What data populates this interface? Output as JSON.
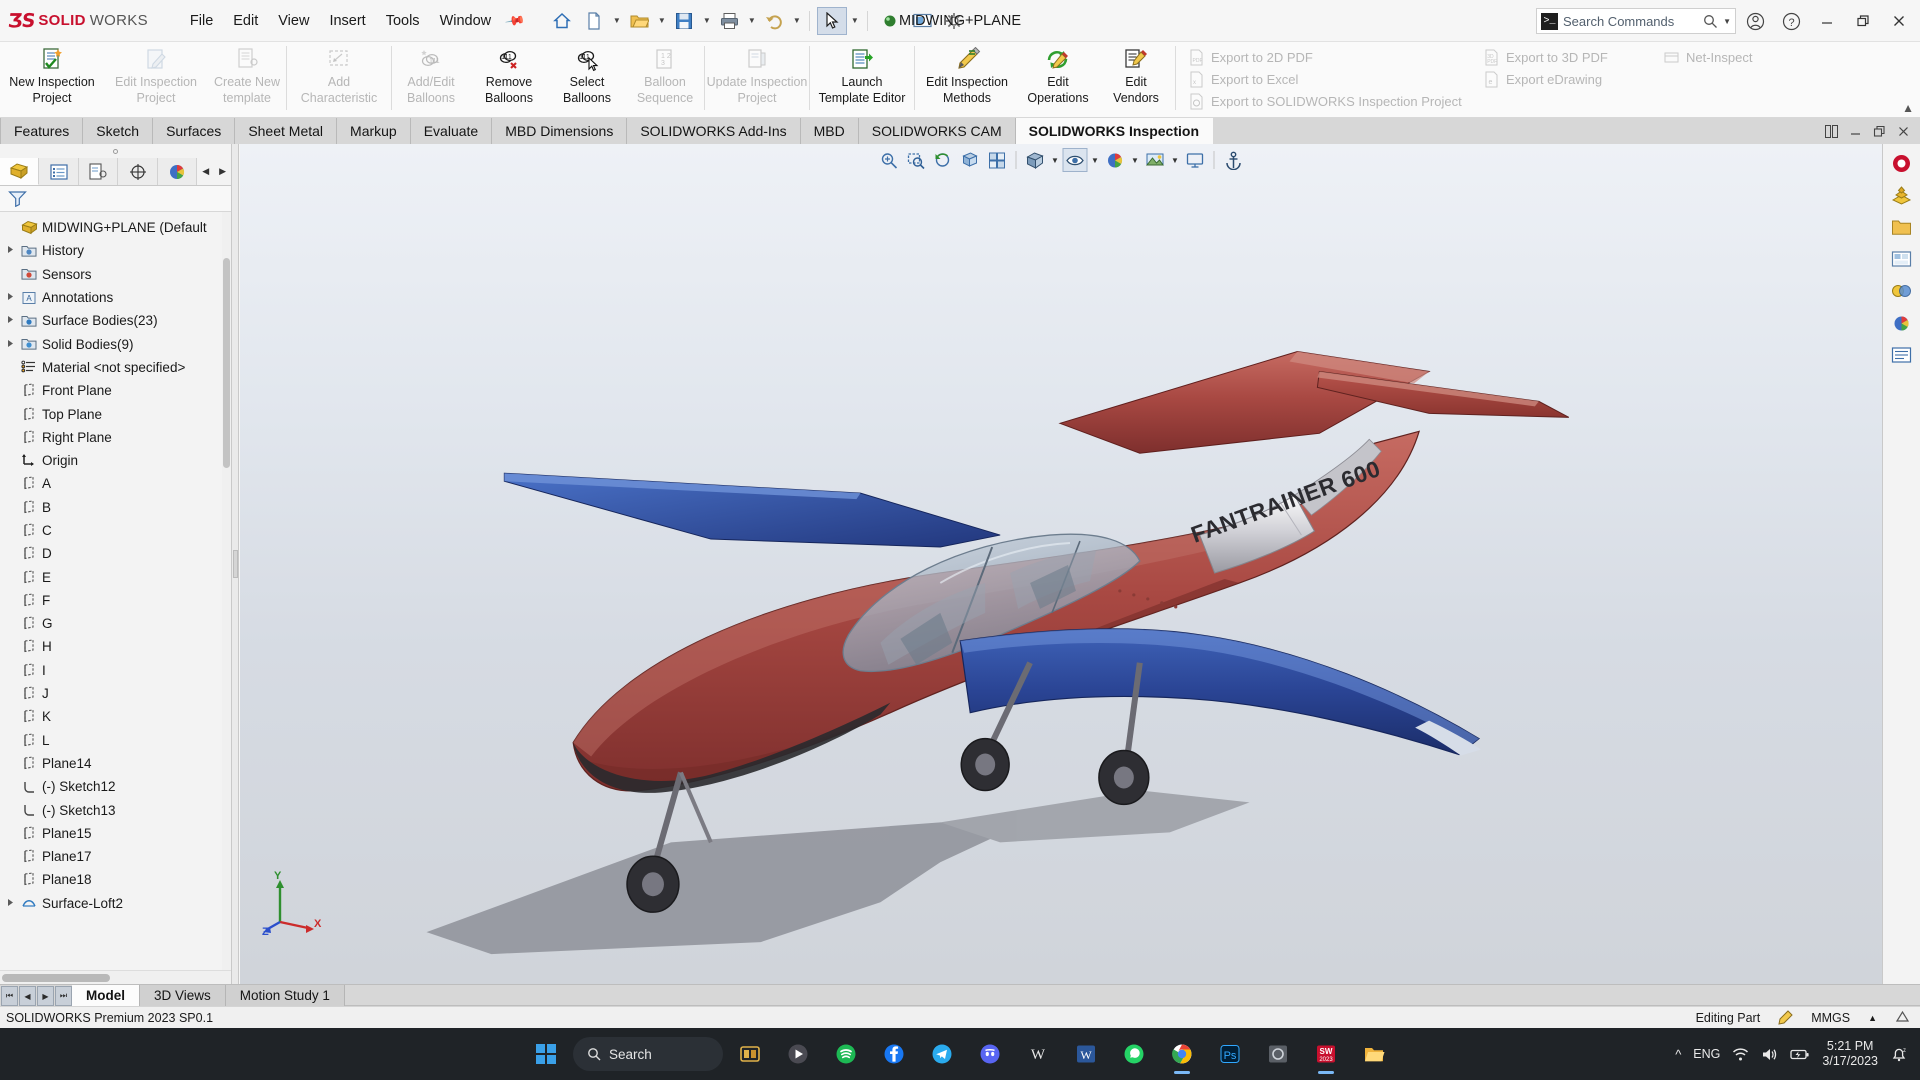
{
  "app": {
    "brand_ds": "ƷS",
    "brand_solid": "SOLID",
    "brand_works": "WORKS",
    "document_title": "MIDWING+PLANE",
    "accent_red": "#c8102e"
  },
  "menubar": {
    "items": [
      {
        "label": "File"
      },
      {
        "label": "Edit"
      },
      {
        "label": "View"
      },
      {
        "label": "Insert"
      },
      {
        "label": "Tools"
      },
      {
        "label": "Window"
      }
    ],
    "pin_icon": "pushpin-icon"
  },
  "quick_access": {
    "buttons": [
      {
        "name": "home-icon"
      },
      {
        "name": "new-document-icon",
        "caret": true
      },
      {
        "name": "open-folder-icon",
        "caret": true
      },
      {
        "name": "save-icon",
        "caret": true
      },
      {
        "name": "print-icon",
        "caret": true
      },
      {
        "name": "undo-icon",
        "caret": true
      },
      {
        "name": "select-arrow-icon",
        "caret": true,
        "selected": true
      },
      {
        "name": "rebuild-icon"
      },
      {
        "name": "display-settings-icon"
      },
      {
        "name": "options-gear-icon"
      }
    ]
  },
  "search": {
    "placeholder": "Search Commands",
    "prompt_glyph": ">_",
    "icon": "magnifier-icon"
  },
  "window_controls": {
    "account": "user-account-icon",
    "help": "help-question-icon",
    "minimize": "minimize-icon",
    "restore": "restore-icon",
    "close": "close-icon"
  },
  "ribbon": {
    "groups": [
      {
        "buttons": [
          {
            "label": "New Inspection\nProject",
            "label_l1": "New Inspection",
            "label_l2": "Project",
            "icon": "new-inspection-project-icon",
            "disabled": false,
            "width": "w2"
          },
          {
            "label_l1": "Edit Inspection",
            "label_l2": "Project",
            "icon": "edit-inspection-project-icon",
            "disabled": true,
            "width": "w2"
          },
          {
            "label_l1": "Create New",
            "label_l2": "template",
            "icon": "create-new-template-icon",
            "disabled": true,
            "width": "w3"
          }
        ]
      },
      {
        "buttons": [
          {
            "label_l1": "Add",
            "label_l2": "Characteristic",
            "icon": "add-characteristic-icon",
            "disabled": true,
            "width": "w2"
          }
        ]
      },
      {
        "buttons": [
          {
            "label_l1": "Add/Edit",
            "label_l2": "Balloons",
            "icon": "add-edit-balloons-icon",
            "disabled": true,
            "width": "w3"
          },
          {
            "label_l1": "Remove",
            "label_l2": "Balloons",
            "icon": "remove-balloons-icon",
            "disabled": false,
            "width": "w3"
          },
          {
            "label_l1": "Select",
            "label_l2": "Balloons",
            "icon": "select-balloons-icon",
            "disabled": false,
            "width": "w3"
          },
          {
            "label_l1": "Balloon",
            "label_l2": "Sequence",
            "icon": "balloon-sequence-icon",
            "disabled": true,
            "width": "w3"
          }
        ]
      },
      {
        "buttons": [
          {
            "label_l1": "Update Inspection",
            "label_l2": "Project",
            "icon": "update-inspection-project-icon",
            "disabled": true,
            "width": "w2"
          }
        ]
      },
      {
        "buttons": [
          {
            "label_l1": "Launch",
            "label_l2": "Template Editor",
            "icon": "launch-template-editor-icon",
            "disabled": false,
            "width": "w2"
          }
        ]
      },
      {
        "buttons": [
          {
            "label_l1": "Edit Inspection",
            "label_l2": "Methods",
            "icon": "edit-inspection-methods-icon",
            "disabled": false,
            "width": "w2"
          },
          {
            "label_l1": "Edit",
            "label_l2": "Operations",
            "icon": "edit-operations-icon",
            "disabled": false,
            "width": "w3"
          },
          {
            "label_l1": "Edit",
            "label_l2": "Vendors",
            "icon": "edit-vendors-icon",
            "disabled": false,
            "width": "w3"
          }
        ]
      }
    ],
    "export_column_1": [
      {
        "label": "Export to 2D PDF",
        "icon": "export-2d-pdf-icon",
        "disabled": true
      },
      {
        "label": "Export to Excel",
        "icon": "export-excel-icon",
        "disabled": true
      },
      {
        "label": "Export to SOLIDWORKS Inspection Project",
        "icon": "export-inspection-project-icon",
        "disabled": true
      }
    ],
    "export_column_2": [
      {
        "label": "Export to 3D PDF",
        "icon": "export-3d-pdf-icon",
        "disabled": true
      },
      {
        "label": "Export eDrawing",
        "icon": "export-edrawing-icon",
        "disabled": true
      }
    ],
    "net_inspect": {
      "label": "Net-Inspect",
      "icon": "net-inspect-icon",
      "disabled": true
    },
    "collapse_caret": "chevron-up-icon"
  },
  "command_tabs": {
    "tabs": [
      {
        "label": "Features",
        "active": false
      },
      {
        "label": "Sketch",
        "active": false
      },
      {
        "label": "Surfaces",
        "active": false
      },
      {
        "label": "Sheet Metal",
        "active": false
      },
      {
        "label": "Markup",
        "active": false
      },
      {
        "label": "Evaluate",
        "active": false
      },
      {
        "label": "MBD Dimensions",
        "active": false
      },
      {
        "label": "SOLIDWORKS Add-Ins",
        "active": false
      },
      {
        "label": "MBD",
        "active": false
      },
      {
        "label": "SOLIDWORKS CAM",
        "active": false
      },
      {
        "label": "SOLIDWORKS Inspection",
        "active": true
      }
    ],
    "right_buttons": [
      "tile-windows-icon",
      "minimize-doc-icon",
      "restore-doc-icon",
      "close-doc-icon"
    ]
  },
  "feature_manager": {
    "tabs": [
      {
        "name": "feature-manager-tab",
        "icon": "yellow-block-icon",
        "active": true
      },
      {
        "name": "property-manager-tab",
        "icon": "property-list-icon",
        "active": false
      },
      {
        "name": "configuration-manager-tab",
        "icon": "configuration-icon",
        "active": false
      },
      {
        "name": "dimxpert-manager-tab",
        "icon": "dimxpert-icon",
        "active": false
      },
      {
        "name": "display-manager-tab",
        "icon": "color-wheel-icon",
        "active": false
      }
    ],
    "filter_icon": "filter-funnel-icon",
    "root": {
      "label": "MIDWING+PLANE (Default",
      "icon": "part-icon"
    },
    "items": [
      {
        "label": "History",
        "icon": "history-icon",
        "expandable": true,
        "indent": 1
      },
      {
        "label": "Sensors",
        "icon": "sensors-icon",
        "expandable": false,
        "indent": 1
      },
      {
        "label": "Annotations",
        "icon": "annotations-icon",
        "expandable": true,
        "indent": 1
      },
      {
        "label": "Surface Bodies(23)",
        "icon": "surface-bodies-icon",
        "expandable": true,
        "indent": 1
      },
      {
        "label": "Solid Bodies(9)",
        "icon": "solid-bodies-icon",
        "expandable": true,
        "indent": 1
      },
      {
        "label": "Material <not specified>",
        "icon": "material-icon",
        "expandable": false,
        "indent": 1
      },
      {
        "label": "Front Plane",
        "icon": "plane-icon",
        "expandable": false,
        "indent": 1
      },
      {
        "label": "Top Plane",
        "icon": "plane-icon",
        "expandable": false,
        "indent": 1
      },
      {
        "label": "Right Plane",
        "icon": "plane-icon",
        "expandable": false,
        "indent": 1
      },
      {
        "label": "Origin",
        "icon": "origin-icon",
        "expandable": false,
        "indent": 1
      },
      {
        "label": "A",
        "icon": "plane-icon",
        "expandable": false,
        "indent": 1
      },
      {
        "label": "B",
        "icon": "plane-icon",
        "expandable": false,
        "indent": 1
      },
      {
        "label": "C",
        "icon": "plane-icon",
        "expandable": false,
        "indent": 1
      },
      {
        "label": "D",
        "icon": "plane-icon",
        "expandable": false,
        "indent": 1
      },
      {
        "label": "E",
        "icon": "plane-icon",
        "expandable": false,
        "indent": 1
      },
      {
        "label": "F",
        "icon": "plane-icon",
        "expandable": false,
        "indent": 1
      },
      {
        "label": "G",
        "icon": "plane-icon",
        "expandable": false,
        "indent": 1
      },
      {
        "label": "H",
        "icon": "plane-icon",
        "expandable": false,
        "indent": 1
      },
      {
        "label": "I",
        "icon": "plane-icon",
        "expandable": false,
        "indent": 1
      },
      {
        "label": "J",
        "icon": "plane-icon",
        "expandable": false,
        "indent": 1
      },
      {
        "label": "K",
        "icon": "plane-icon",
        "expandable": false,
        "indent": 1
      },
      {
        "label": "L",
        "icon": "plane-icon",
        "expandable": false,
        "indent": 1
      },
      {
        "label": "Plane14",
        "icon": "plane-icon",
        "expandable": false,
        "indent": 1
      },
      {
        "label": "(-) Sketch12",
        "icon": "sketch-icon",
        "expandable": false,
        "indent": 1
      },
      {
        "label": "(-) Sketch13",
        "icon": "sketch-icon",
        "expandable": false,
        "indent": 1
      },
      {
        "label": "Plane15",
        "icon": "plane-icon",
        "expandable": false,
        "indent": 1
      },
      {
        "label": "Plane17",
        "icon": "plane-icon",
        "expandable": false,
        "indent": 1
      },
      {
        "label": "Plane18",
        "icon": "plane-icon",
        "expandable": false,
        "indent": 1
      },
      {
        "label": "Surface-Loft2",
        "icon": "surface-loft-icon",
        "expandable": true,
        "indent": 1
      }
    ]
  },
  "view_toolbar": {
    "buttons": [
      {
        "name": "zoom-to-fit-icon"
      },
      {
        "name": "zoom-to-area-icon"
      },
      {
        "name": "previous-view-icon"
      },
      {
        "name": "section-view-icon"
      },
      {
        "name": "view-orientation-icon"
      },
      {
        "name": "display-style-icon",
        "caret": true
      },
      {
        "name": "hide-show-items-icon",
        "caret": true,
        "selected": true
      },
      {
        "name": "edit-appearance-icon",
        "caret": true
      },
      {
        "name": "apply-scene-icon",
        "caret": true
      },
      {
        "name": "view-settings-icon"
      }
    ]
  },
  "triad": {
    "x_label": "X",
    "y_label": "Y",
    "z_label": "Z"
  },
  "model": {
    "name": "MIDWING+PLANE",
    "fuselage_text": "FANTRAINER 600",
    "colors": {
      "fuselage_red": "#a83a36",
      "wing_blue": "#2a4a9e",
      "metal_silver": "#d8d8dc",
      "canopy_glass": "#9aa6b4"
    }
  },
  "task_pane": {
    "buttons": [
      {
        "name": "solidworks-resources-icon"
      },
      {
        "name": "design-library-icon"
      },
      {
        "name": "file-explorer-icon"
      },
      {
        "name": "view-palette-icon"
      },
      {
        "name": "appearances-scenes-icon"
      },
      {
        "name": "custom-properties-icon"
      },
      {
        "name": "solidworks-forum-icon"
      }
    ]
  },
  "document_tabs": {
    "nav": [
      "first-icon",
      "previous-icon",
      "next-icon",
      "last-icon"
    ],
    "tabs": [
      {
        "label": "Model",
        "active": true
      },
      {
        "label": "3D Views",
        "active": false
      },
      {
        "label": "Motion Study 1",
        "active": false
      }
    ]
  },
  "status_bar": {
    "version": "SOLIDWORKS Premium 2023 SP0.1",
    "editing_state": "Editing Part",
    "units": "MMGS",
    "edit_icon": "editing-pencil-icon",
    "caret": "chevron-up-icon",
    "overlay_icon": "overlay-icon"
  },
  "taskbar": {
    "start_icon": "windows-start-icon",
    "search_label": "Search",
    "search_icon": "magnifier-icon",
    "pinned": [
      {
        "name": "task-view-icon",
        "running": false
      },
      {
        "name": "media-player-icon",
        "running": false
      },
      {
        "name": "spotify-icon",
        "running": false
      },
      {
        "name": "facebook-icon",
        "running": false
      },
      {
        "name": "telegram-icon",
        "running": false
      },
      {
        "name": "discord-icon",
        "running": false
      },
      {
        "name": "wikipedia-icon",
        "running": false
      },
      {
        "name": "word-icon",
        "running": false
      },
      {
        "name": "whatsapp-icon",
        "running": false
      },
      {
        "name": "chrome-icon",
        "running": true
      },
      {
        "name": "photoshop-icon",
        "running": false
      },
      {
        "name": "unknown-app-icon",
        "running": false
      },
      {
        "name": "solidworks-icon",
        "running": true
      },
      {
        "name": "file-explorer-icon",
        "running": false
      }
    ],
    "tray": {
      "expand": "chevron-up-icon",
      "language": "ENG",
      "wifi": "wifi-icon",
      "volume": "speaker-icon",
      "battery": "battery-charging-icon",
      "time": "5:21 PM",
      "date": "3/17/2023",
      "notifications": "notification-bell-icon"
    }
  }
}
